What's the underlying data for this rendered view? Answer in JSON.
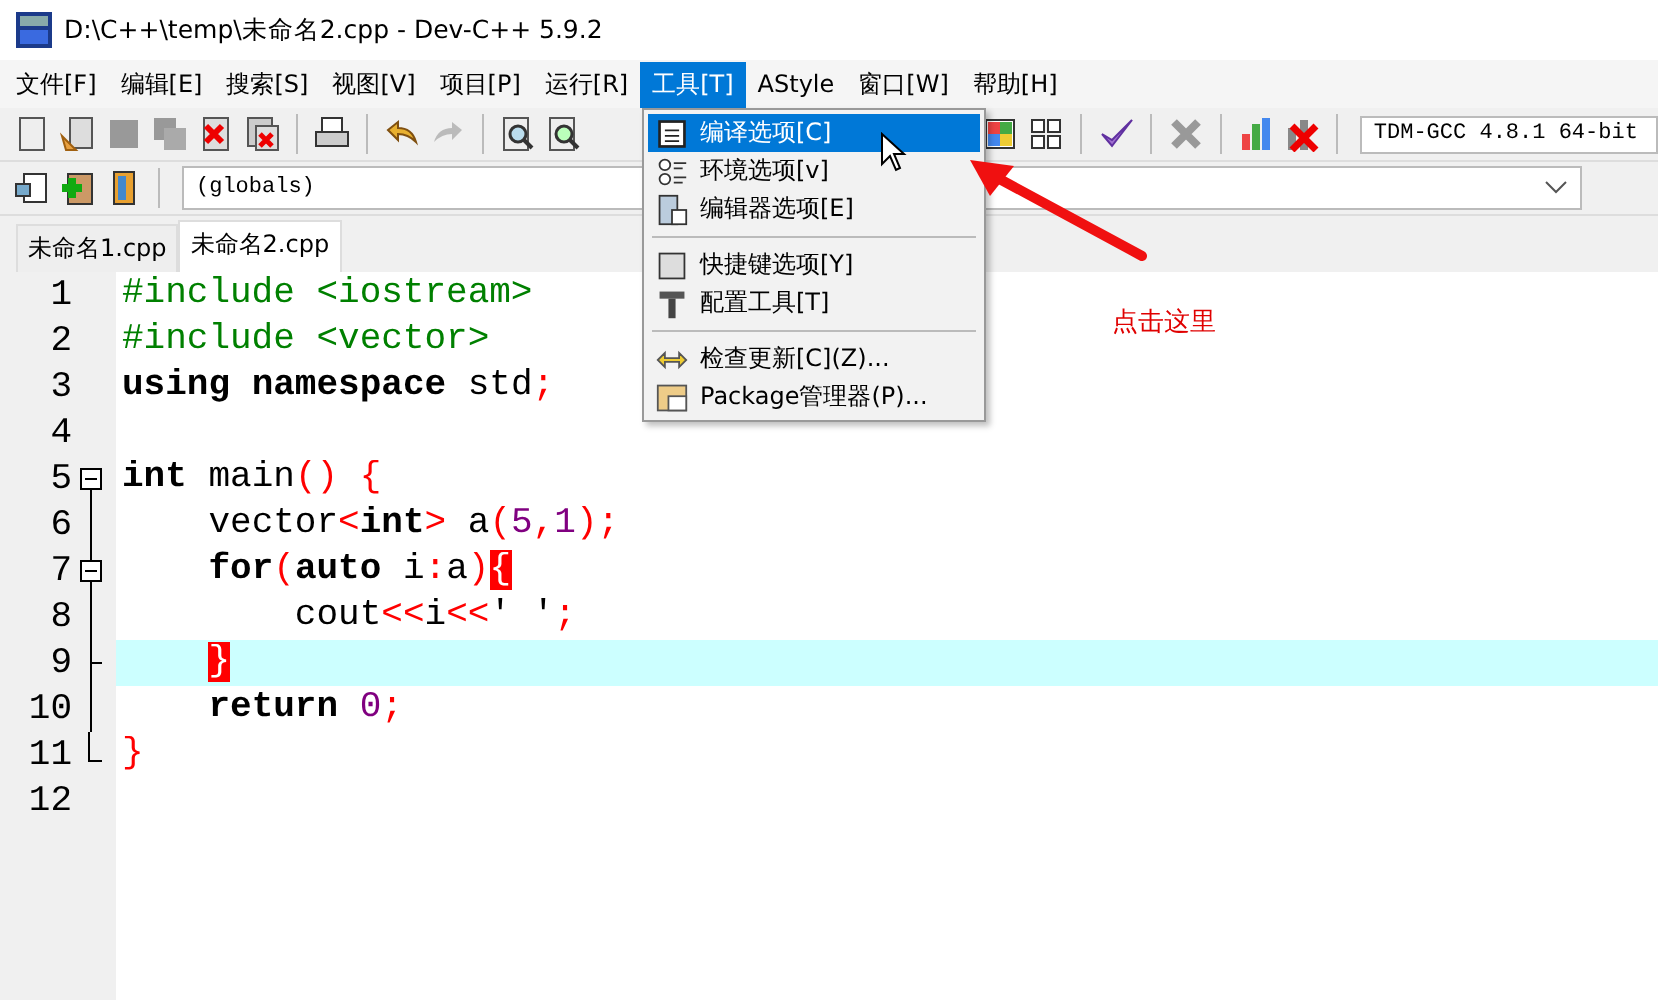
{
  "window": {
    "title": "D:\\C++\\temp\\未命名2.cpp - Dev-C++ 5.9.2"
  },
  "menu_bar": [
    {
      "label": "文件[F]",
      "selected": false
    },
    {
      "label": "编辑[E]",
      "selected": false
    },
    {
      "label": "搜索[S]",
      "selected": false
    },
    {
      "label": "视图[V]",
      "selected": false
    },
    {
      "label": "项目[P]",
      "selected": false
    },
    {
      "label": "运行[R]",
      "selected": false
    },
    {
      "label": "工具[T]",
      "selected": true
    },
    {
      "label": "AStyle",
      "selected": false
    },
    {
      "label": "窗口[W]",
      "selected": false
    },
    {
      "label": "帮助[H]",
      "selected": false
    }
  ],
  "compiler_select": {
    "value": "TDM-GCC 4.8.1 64-bit"
  },
  "scope_select": {
    "value": "(globals)"
  },
  "tabs": [
    {
      "label": "未命名1.cpp",
      "selected": false
    },
    {
      "label": "未命名2.cpp",
      "selected": true
    }
  ],
  "editor": {
    "lines": [
      {
        "number": "1",
        "current": false,
        "text": "#include <iostream>"
      },
      {
        "number": "2",
        "current": false,
        "text": "#include <vector>"
      },
      {
        "number": "3",
        "current": false,
        "text": "using namespace std;"
      },
      {
        "number": "4",
        "current": false
      },
      {
        "number": "5",
        "current": false,
        "expanded": true,
        "text": "int main() {"
      },
      {
        "number": "6",
        "current": false,
        "text": "    vector<int> a(5,1);"
      },
      {
        "number": "7",
        "current": false,
        "expanded": true,
        "bracket_match": true,
        "text": "    for(auto i:a){"
      },
      {
        "number": "8",
        "current": false,
        "text": "        cout<<i<<' ';"
      },
      {
        "number": "9",
        "current": true,
        "bracket_match": true,
        "text": "    }"
      },
      {
        "number": "10",
        "current": false,
        "text": "    return 0;"
      },
      {
        "number": "11",
        "current": false,
        "text": "}"
      },
      {
        "number": "12",
        "current": false
      }
    ]
  },
  "tools_menu": {
    "items": [
      {
        "kind": "item",
        "label": "编译选项[C]",
        "selected": true
      },
      {
        "kind": "item",
        "label": "环境选项[v]",
        "selected": false
      },
      {
        "kind": "item",
        "label": "编辑器选项[E]",
        "selected": false
      },
      {
        "kind": "separator"
      },
      {
        "kind": "item",
        "label": "快捷键选项[Y]",
        "selected": false
      },
      {
        "kind": "item",
        "label": "配置工具[T]",
        "selected": false
      },
      {
        "kind": "separator"
      },
      {
        "kind": "item",
        "label": "检查更新[C](Z)...",
        "selected": false
      },
      {
        "kind": "item",
        "label": "Package管理器(P)...",
        "selected": false
      }
    ]
  },
  "annotation": {
    "text": "点击这里"
  }
}
